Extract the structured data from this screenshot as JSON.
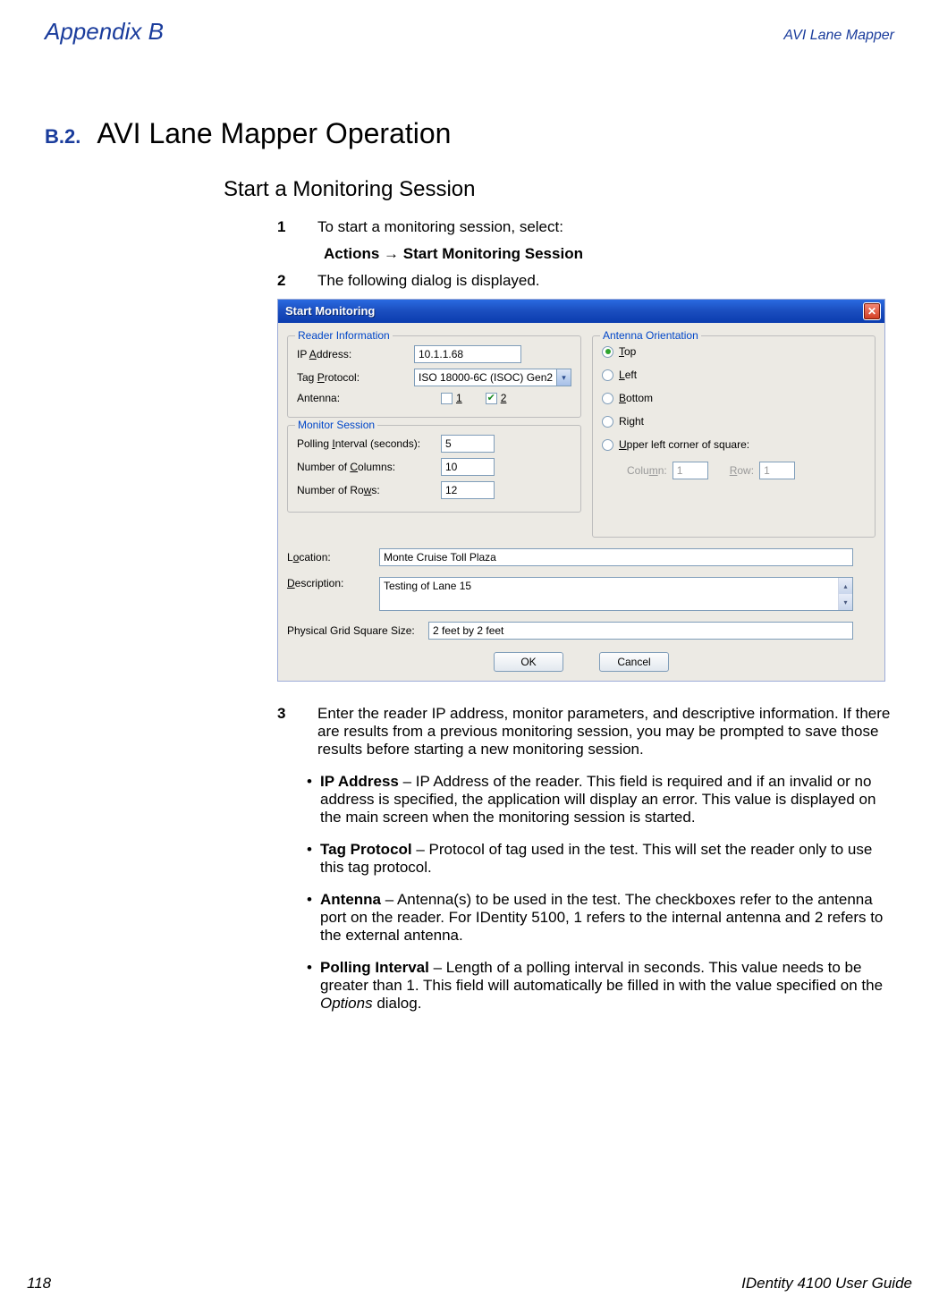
{
  "header": {
    "left": "Appendix B",
    "right": "AVI Lane Mapper"
  },
  "section": {
    "num": "B.2.",
    "title": "AVI Lane Mapper Operation"
  },
  "subtitle": "Start a Monitoring Session",
  "steps": {
    "s1_num": "1",
    "s1_text": "To start a monitoring session, select:",
    "action_path": "Actions → Start Monitoring Session",
    "s2_num": "2",
    "s2_text": "The following dialog is displayed.",
    "s3_num": "3",
    "s3_text": "Enter the reader IP address, monitor parameters, and descriptive information. If there are results from a previous monitoring session, you may be prompted to save those results before starting a new monitoring session."
  },
  "dialog": {
    "title": "Start Monitoring",
    "reader": {
      "legend": "Reader Information",
      "ip_label": "IP Address:",
      "ip_value": "10.1.1.68",
      "tag_label": "Tag Protocol:",
      "tag_value": "ISO 18000-6C (ISOC) Gen2",
      "ant_label": "Antenna:",
      "ant1": "1",
      "ant2": "2"
    },
    "session": {
      "legend": "Monitor Session",
      "poll_label": "Polling Interval (seconds):",
      "poll_value": "5",
      "cols_label": "Number of Columns:",
      "cols_value": "10",
      "rows_label": "Number of Rows:",
      "rows_value": "12"
    },
    "orient": {
      "legend": "Antenna Orientation",
      "top": "Top",
      "left": "Left",
      "bottom": "Bottom",
      "right": "Right",
      "upper": "Upper left corner of square:",
      "col_label": "Column:",
      "col_value": "1",
      "row_label": "Row:",
      "row_value": "1"
    },
    "location_label": "Location:",
    "location_value": "Monte Cruise Toll Plaza",
    "desc_label": "Description:",
    "desc_value": "Testing of Lane 15",
    "grid_label": "Physical Grid Square Size:",
    "grid_value": "2 feet by 2 feet",
    "ok": "OK",
    "cancel": "Cancel"
  },
  "bullets": {
    "ip_term": "IP Address",
    "ip_text": " – IP Address of the reader. This field is required and if an invalid or no address is specified, the application will display an error. This value is displayed on the main screen when the monitoring session is started.",
    "tag_term": "Tag Protocol",
    "tag_text": " – Protocol of tag used in the test. This will set the reader only to use this tag protocol.",
    "ant_term": "Antenna",
    "ant_text": " – Antenna(s) to be used in the test. The checkboxes refer to the antenna port on the reader. For IDentity 5100, 1 refers to the internal antenna and 2 refers to the external antenna.",
    "poll_term": "Polling Interval",
    "poll_text_a": " – Length of a polling interval in seconds. This value needs to be greater than 1. This field will automatically be filled in with the value specified on the ",
    "poll_opt": "Options",
    "poll_text_b": " dialog."
  },
  "footer": {
    "page": "118",
    "guide": "IDentity 4100 User Guide"
  }
}
